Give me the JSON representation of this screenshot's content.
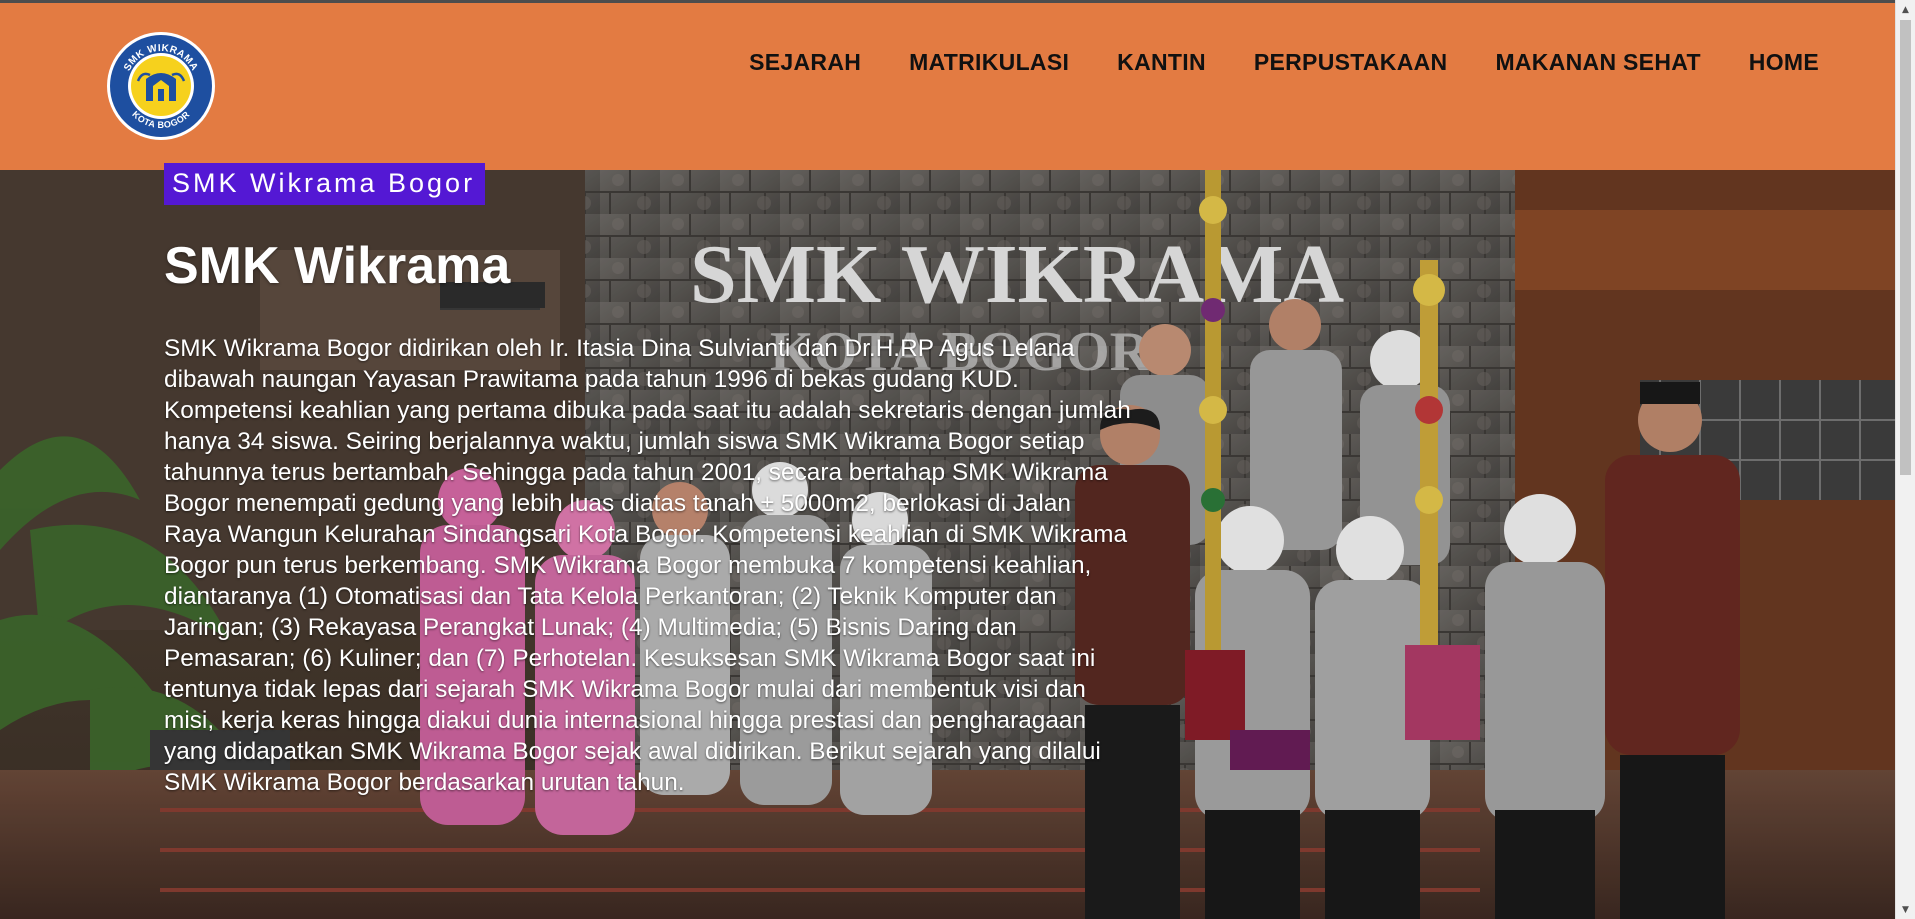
{
  "header": {
    "logo": {
      "top_text": "SMK WIKRAMA",
      "bottom_text": "KOTA BOGOR",
      "icon": "school-emblem-icon"
    },
    "nav": [
      {
        "label": "SEJARAH"
      },
      {
        "label": "MATRIKULASI"
      },
      {
        "label": "KANTIN"
      },
      {
        "label": "PERPUSTAKAAN"
      },
      {
        "label": "MAKANAN SEHAT"
      },
      {
        "label": "HOME"
      }
    ]
  },
  "hero": {
    "badge": "SMK Wikrama Bogor",
    "title": "SMK Wikrama",
    "paragraph": "SMK Wikrama Bogor didirikan oleh Ir. Itasia Dina Sulvianti dan Dr.H.RP Agus Lelana dibawah naungan Yayasan Prawitama pada tahun 1996 di bekas gudang KUD. Kompetensi keahlian yang pertama dibuka pada saat itu adalah sekretaris dengan jumlah hanya 34 siswa. Seiring berjalannya waktu, jumlah siswa SMK Wikrama Bogor setiap tahunnya terus bertambah. Sehingga pada tahun 2001, secara bertahap SMK Wikrama Bogor menempati gedung yang lebih luas diatas tanah ± 5000m2, berlokasi di Jalan Raya Wangun Kelurahan Sindangsari Kota Bogor. Kompetensi keahlian di SMK Wikrama Bogor pun terus berkembang. SMK Wikrama Bogor membuka 7 kompetensi keahlian, diantaranya (1) Otomatisasi dan Tata Kelola Perkantoran; (2) Teknik Komputer dan Jaringan; (3) Rekayasa Perangkat Lunak; (4) Multimedia; (5) Bisnis Daring dan Pemasaran; (6) Kuliner; dan (7) Perhotelan. Kesuksesan SMK Wikrama Bogor saat ini tentunya tidak lepas dari sejarah SMK Wikrama Bogor mulai dari membentuk visi dan misi, kerja keras hingga diakui dunia internasional hingga prestasi dan pengharagaan yang didapatkan SMK Wikrama Bogor sejak awal didirikan. Berikut sejarah yang dilalui SMK Wikrama Bogor berdasarkan urutan tahun.",
    "photo_sign_text": "SMK WIKRAMA",
    "photo_sign_sub": "KOTA BOGOR"
  },
  "colors": {
    "header_bg": "#e37b42",
    "badge_bg": "#5418d4",
    "nav_text": "#111111"
  }
}
